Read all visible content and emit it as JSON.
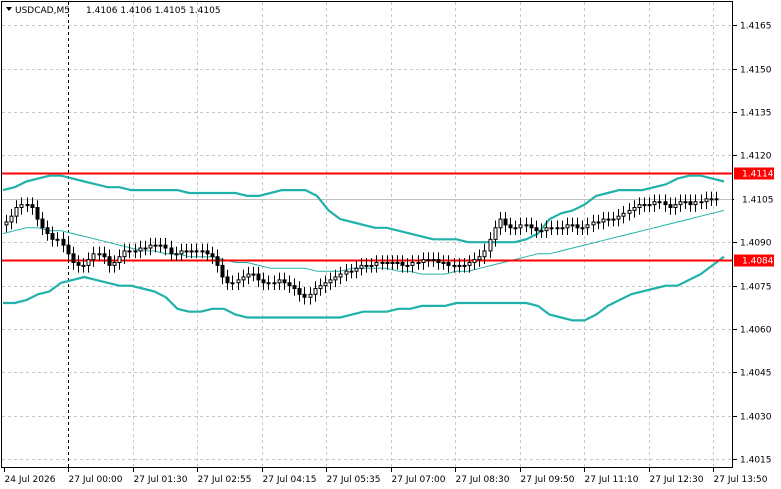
{
  "header": {
    "symbol": "USDCAD,M5",
    "ohlc": "1.4106 1.4106 1.4105 1.4105"
  },
  "colors": {
    "candle": "#000000",
    "bollinger": "#20b2aa",
    "level_line": "#ff0000",
    "level_label_bg": "#ff0000",
    "price_label_bg": "#ffffff",
    "grid": "#c8c8c8",
    "current_price_line": "#c0c0c0"
  },
  "chart_data": {
    "type": "candlestick",
    "ylim": [
      1.4012,
      1.4173
    ],
    "y_ticks": [
      "1.4165",
      "1.4150",
      "1.4135",
      "1.4120",
      "1.4105",
      "1.4090",
      "1.4075",
      "1.4060",
      "1.4045",
      "1.4030",
      "1.4015"
    ],
    "x_ticks": [
      "24 Jul 2026",
      "27 Jul 00:00",
      "27 Jul 01:30",
      "27 Jul 02:55",
      "27 Jul 04:15",
      "27 Jul 05:35",
      "27 Jul 07:00",
      "27 Jul 08:30",
      "27 Jul 09:50",
      "27 Jul 11:10",
      "27 Jul 12:30",
      "27 Jul 13:50"
    ],
    "levels": [
      {
        "value": 1.4114,
        "label": "1.4114"
      },
      {
        "value": 1.4084,
        "label": "1.4084"
      }
    ],
    "current_price": {
      "value": 1.4105,
      "label": "1.4105"
    },
    "session_break_tick": 1,
    "close": [
      1.4097,
      1.4099,
      1.4102,
      1.4103,
      1.4103,
      1.4102,
      1.4098,
      1.4095,
      1.4093,
      1.4091,
      1.4091,
      1.4089,
      1.4086,
      1.4083,
      1.4082,
      1.4082,
      1.4084,
      1.4086,
      1.4086,
      1.4085,
      1.4082,
      1.4083,
      1.4085,
      1.4087,
      1.4087,
      1.4087,
      1.4088,
      1.4088,
      1.4089,
      1.4089,
      1.4089,
      1.4088,
      1.4086,
      1.4086,
      1.4087,
      1.4087,
      1.4087,
      1.4087,
      1.4087,
      1.4086,
      1.4085,
      1.4082,
      1.4078,
      1.4076,
      1.4076,
      1.4077,
      1.4078,
      1.4079,
      1.4079,
      1.4077,
      1.4076,
      1.4076,
      1.4076,
      1.4077,
      1.4076,
      1.4075,
      1.4074,
      1.4072,
      1.4071,
      1.4072,
      1.4074,
      1.4075,
      1.4076,
      1.4077,
      1.4078,
      1.4079,
      1.408,
      1.408,
      1.4081,
      1.4082,
      1.4082,
      1.4082,
      1.4083,
      1.4083,
      1.4083,
      1.4083,
      1.4083,
      1.4082,
      1.4082,
      1.4083,
      1.4083,
      1.4084,
      1.4084,
      1.4084,
      1.4083,
      1.4083,
      1.4082,
      1.4082,
      1.4082,
      1.4082,
      1.4083,
      1.4084,
      1.4085,
      1.4087,
      1.4091,
      1.4095,
      1.4098,
      1.4096,
      1.4095,
      1.4095,
      1.4096,
      1.4096,
      1.4095,
      1.4094,
      1.4094,
      1.4095,
      1.4095,
      1.4095,
      1.4095,
      1.4096,
      1.4096,
      1.4095,
      1.4095,
      1.4096,
      1.4097,
      1.4097,
      1.4098,
      1.4098,
      1.4098,
      1.4099,
      1.41,
      1.4101,
      1.4102,
      1.4103,
      1.4103,
      1.4103,
      1.4104,
      1.4104,
      1.4103,
      1.4102,
      1.4103,
      1.4104,
      1.4104,
      1.4103,
      1.4104,
      1.4104,
      1.4105,
      1.4105,
      1.4105
    ],
    "bollinger_upper": [
      1.4108,
      1.4109,
      1.4111,
      1.4112,
      1.4113,
      1.4113,
      1.4112,
      1.4111,
      1.411,
      1.4109,
      1.4109,
      1.4108,
      1.4108,
      1.4108,
      1.4108,
      1.4108,
      1.4107,
      1.4107,
      1.4107,
      1.4107,
      1.4107,
      1.4106,
      1.4106,
      1.4107,
      1.4108,
      1.4108,
      1.4108,
      1.4106,
      1.4101,
      1.4098,
      1.4097,
      1.4096,
      1.4095,
      1.4095,
      1.4094,
      1.4093,
      1.4092,
      1.4091,
      1.4091,
      1.4091,
      1.409,
      1.409,
      1.409,
      1.409,
      1.409,
      1.4091,
      1.4093,
      1.4098,
      1.41,
      1.4101,
      1.4103,
      1.4106,
      1.4107,
      1.4108,
      1.4108,
      1.4108,
      1.4109,
      1.411,
      1.4112,
      1.4113,
      1.4113,
      1.4112,
      1.4111
    ],
    "bollinger_middle": [
      1.4093,
      1.4094,
      1.4095,
      1.4095,
      1.4094,
      1.4094,
      1.4093,
      1.4092,
      1.4091,
      1.409,
      1.4089,
      1.4088,
      1.4087,
      1.4087,
      1.4086,
      1.4086,
      1.4085,
      1.4085,
      1.4085,
      1.4084,
      1.4083,
      1.4083,
      1.4082,
      1.4081,
      1.4081,
      1.4081,
      1.4081,
      1.408,
      1.408,
      1.408,
      1.4081,
      1.4081,
      1.4081,
      1.4081,
      1.408,
      1.408,
      1.4079,
      1.4079,
      1.4079,
      1.408,
      1.408,
      1.4081,
      1.4082,
      1.4083,
      1.4084,
      1.4085,
      1.4086,
      1.4086,
      1.4087,
      1.4088,
      1.4089,
      1.409,
      1.4091,
      1.4092,
      1.4093,
      1.4094,
      1.4095,
      1.4096,
      1.4097,
      1.4098,
      1.4099,
      1.41,
      1.4101
    ],
    "bollinger_lower": [
      1.4069,
      1.4069,
      1.407,
      1.4072,
      1.4073,
      1.4076,
      1.4077,
      1.4078,
      1.4077,
      1.4076,
      1.4075,
      1.4075,
      1.4074,
      1.4073,
      1.4071,
      1.4067,
      1.4066,
      1.4066,
      1.4067,
      1.4067,
      1.4065,
      1.4064,
      1.4064,
      1.4064,
      1.4064,
      1.4064,
      1.4064,
      1.4064,
      1.4064,
      1.4064,
      1.4065,
      1.4066,
      1.4066,
      1.4066,
      1.4067,
      1.4067,
      1.4068,
      1.4068,
      1.4068,
      1.4069,
      1.4069,
      1.4069,
      1.4069,
      1.4069,
      1.4069,
      1.4069,
      1.4068,
      1.4065,
      1.4064,
      1.4063,
      1.4063,
      1.4065,
      1.4068,
      1.407,
      1.4072,
      1.4073,
      1.4074,
      1.4075,
      1.4075,
      1.4077,
      1.4079,
      1.4082,
      1.4085
    ]
  }
}
